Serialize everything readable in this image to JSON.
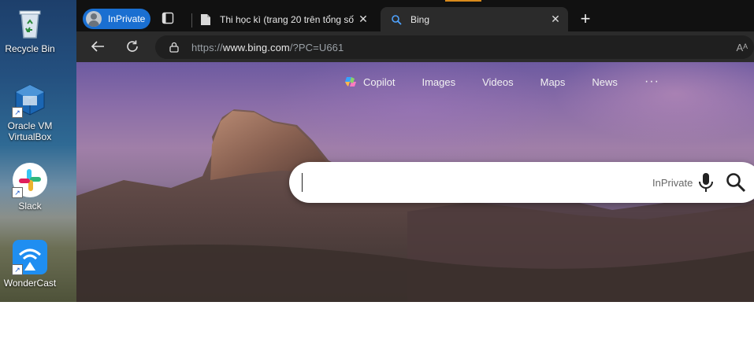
{
  "desktop": {
    "icons": [
      {
        "label": "Recycle Bin",
        "icon": "recycle-bin-icon"
      },
      {
        "label": "Oracle VM VirtualBox",
        "icon": "virtualbox-icon"
      },
      {
        "label": "Slack",
        "icon": "slack-icon"
      },
      {
        "label": "WonderCast",
        "icon": "wondercast-icon"
      }
    ]
  },
  "browser": {
    "profile_label": "InPrivate",
    "tabs": [
      {
        "title": "Thi học kì (trang 20 trên tổng số",
        "favicon": "document-icon",
        "active": false
      },
      {
        "title": "Bing",
        "favicon": "search-icon",
        "active": true
      }
    ],
    "address": {
      "prefix": "https://",
      "host": "www.bing.com",
      "path": "/?PC=U661"
    },
    "read_aloud": "Aᴬ"
  },
  "bing": {
    "nav": [
      {
        "label": "Copilot",
        "icon": "copilot-icon"
      },
      {
        "label": "Images"
      },
      {
        "label": "Videos"
      },
      {
        "label": "Maps"
      },
      {
        "label": "News"
      }
    ],
    "more_label": "···",
    "search": {
      "value": "",
      "inprivate_label": "InPrivate"
    }
  },
  "colors": {
    "accent_blue": "#1a6fd1",
    "tabstrip": "#111111",
    "toolbar": "#2b2b2b"
  }
}
